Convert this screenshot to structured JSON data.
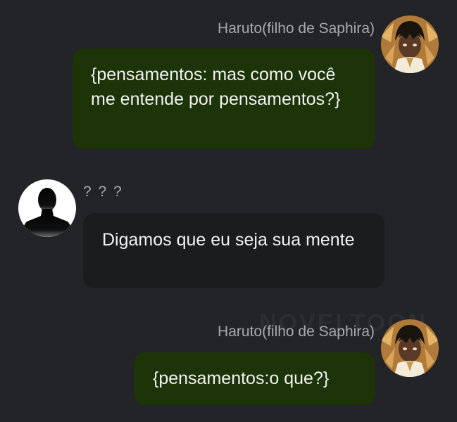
{
  "messages": [
    {
      "sender": "Haruto(filho de Saphira)",
      "text": "{pensamentos: mas como você me entende por pensamentos?}",
      "avatar_icon": "anime-character-avatar"
    },
    {
      "sender": "? ? ?",
      "text": "Digamos que eu seja sua mente",
      "avatar_icon": "silhouette-avatar"
    },
    {
      "sender": "Haruto(filho de Saphira)",
      "text": "{pensamentos:o que?}",
      "avatar_icon": "anime-character-avatar"
    }
  ],
  "watermark": "NOVELTOON",
  "colors": {
    "background": "#232427",
    "self_bubble": "#1d3408",
    "other_bubble": "#1b1c1e",
    "name_text": "#a9aaad",
    "message_text": "#f1f2f2"
  }
}
